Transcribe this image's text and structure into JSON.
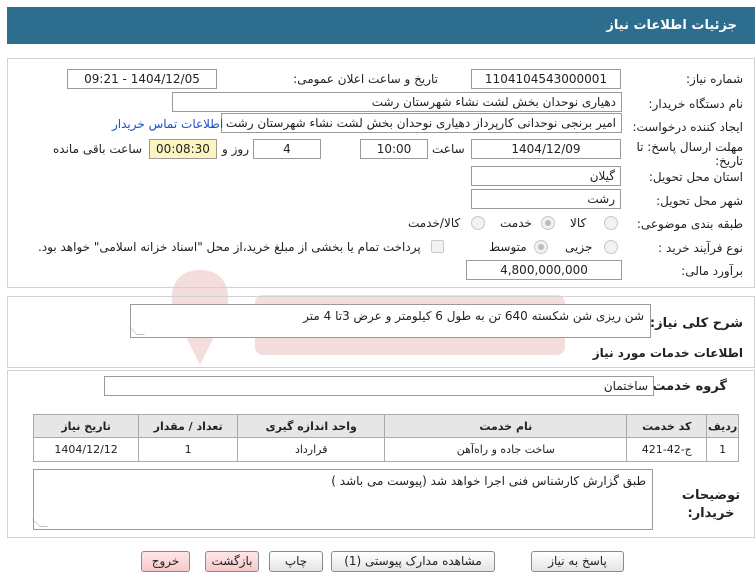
{
  "header": {
    "title": "جزئیات اطلاعات نیاز"
  },
  "need_number": {
    "label": "شماره نیاز:",
    "value": "1104104543000001"
  },
  "announce": {
    "label": "تاریخ و ساعت اعلان عمومی:",
    "value": "1404/12/05 - 09:21"
  },
  "buyer_org": {
    "label": "نام دستگاه خریدار:",
    "value": "دهیاری نوحدان بخش لشت نشاء شهرستان رشت"
  },
  "requester": {
    "label": "ایجاد کننده درخواست:",
    "value": "امیر برنجی نوحدانی کارپرداز دهیاری نوحدان بخش لشت نشاء شهرستان رشت",
    "contact_link": "اطلاعات تماس خریدار"
  },
  "deadline": {
    "label_line1": "مهلت ارسال پاسخ: تا",
    "label_line2": "تاریخ:",
    "date": "1404/12/09",
    "time_label": "ساعت",
    "time": "10:00",
    "days": "4",
    "days_label": "روز و",
    "remaining": "00:08:30",
    "remaining_label": "ساعت باقی مانده"
  },
  "province": {
    "label": "استان محل تحویل:",
    "value": "گیلان"
  },
  "city": {
    "label": "شهر محل تحویل:",
    "value": "رشت"
  },
  "category": {
    "label": "طبقه بندی موضوعی:",
    "options": [
      "کالا",
      "خدمت",
      "کالا/خدمت"
    ],
    "selected": "خدمت"
  },
  "purchase_type": {
    "label": "نوع فرآیند خرید :",
    "options": [
      "جزیی",
      "متوسط"
    ],
    "selected": "متوسط",
    "note": "پرداخت تمام یا بخشی از مبلغ خرید،از محل \"اسناد خزانه اسلامی\" خواهد بود."
  },
  "budget": {
    "label": "برآورد مالی:",
    "value": "4,800,000,000"
  },
  "general_desc": {
    "label": "شرح کلی نیاز:",
    "value": "شن ریزی شن شکسته 640 تن به طول 6 کیلومتر و عرض 3تا 4 متر"
  },
  "services_info": {
    "title": "اطلاعات خدمات مورد نیاز"
  },
  "service_group": {
    "label": "گروه خدمت:",
    "value": "ساختمان"
  },
  "table": {
    "headers": [
      "ردیف",
      "کد خدمت",
      "نام خدمت",
      "واحد اندازه گیری",
      "تعداد / مقدار",
      "تاریخ نیاز"
    ],
    "rows": [
      [
        "1",
        "ج-42-421",
        "ساخت جاده و راه‌آهن",
        "قرارداد",
        "1",
        "1404/12/12"
      ]
    ]
  },
  "buyer_notes": {
    "label": "توضیحات خریدار:",
    "value": "طبق گزارش کارشناس فنی اجرا خواهد شد (پیوست می باشد )"
  },
  "buttons": {
    "reply": "پاسخ به نیاز",
    "attachments": "مشاهده مدارک پیوستی (1)",
    "print": "چاپ",
    "back": "بازگشت",
    "exit": "خروج"
  },
  "colors": {
    "header": "#2d6e8e",
    "link": "#1a4fc4",
    "remaining_bg": "#fdf5c0",
    "button_pink": "#f7c9c9"
  }
}
